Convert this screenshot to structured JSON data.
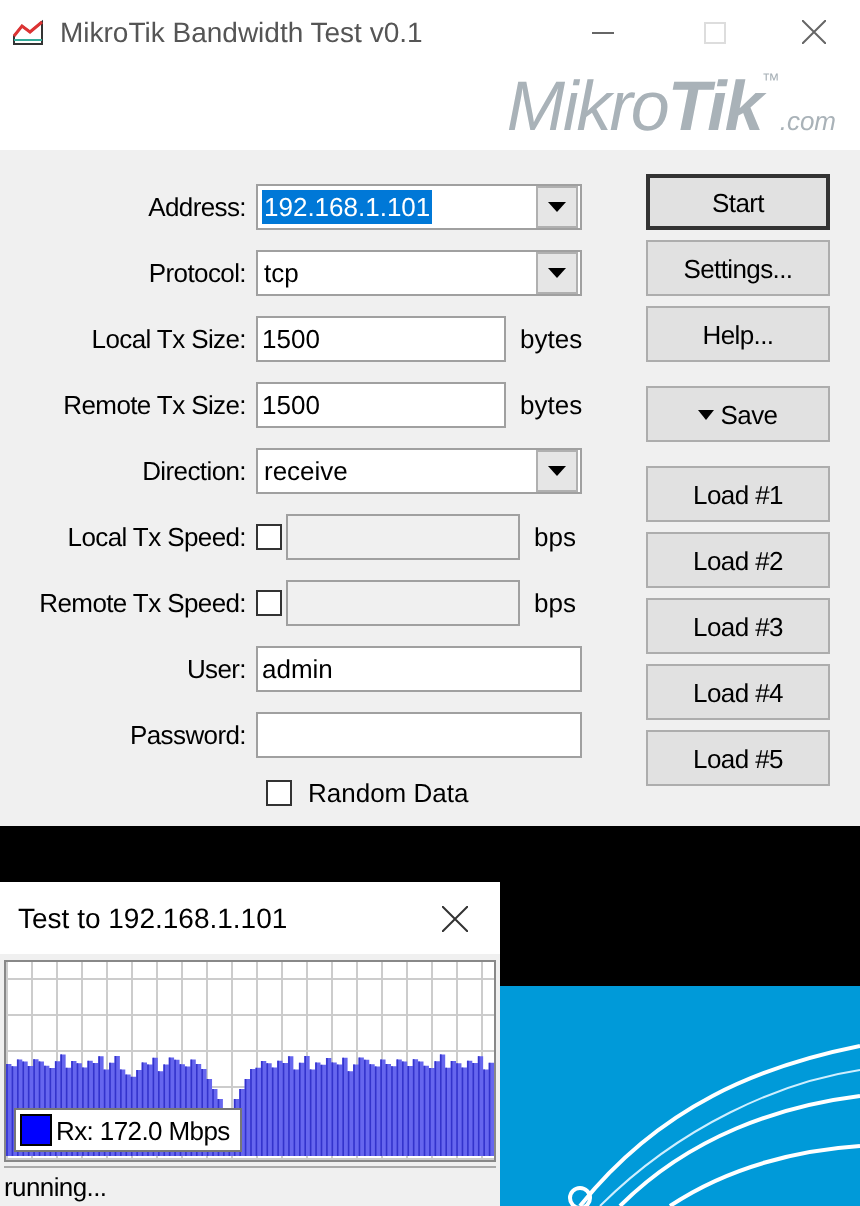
{
  "window": {
    "title": "MikroTik Bandwidth Test v0.1",
    "maximize_disabled": true
  },
  "logo": {
    "word": "Mikro",
    "bold_word": "Tik",
    "mark": "™",
    "suffix": ".com"
  },
  "form": {
    "rows": [
      {
        "kind": "combo",
        "label": "Address:",
        "value": "192.168.1.101",
        "highlighted": true
      },
      {
        "kind": "combo",
        "label": "Protocol:",
        "value": "tcp",
        "highlighted": false
      },
      {
        "kind": "text",
        "label": "Local Tx Size:",
        "value": "1500",
        "unit": "bytes"
      },
      {
        "kind": "text",
        "label": "Remote Tx Size:",
        "value": "1500",
        "unit": "bytes"
      },
      {
        "kind": "combo",
        "label": "Direction:",
        "value": "receive",
        "highlighted": false
      },
      {
        "kind": "speed",
        "label": "Local Tx Speed:",
        "checked": false,
        "unit": "bps"
      },
      {
        "kind": "speed",
        "label": "Remote Tx Speed:",
        "checked": false,
        "unit": "bps"
      },
      {
        "kind": "wide",
        "label": "User:",
        "value": "admin"
      },
      {
        "kind": "wide",
        "label": "Password:"
      }
    ],
    "random_data": {
      "label": "Random Data",
      "checked": false
    }
  },
  "buttons": [
    {
      "kind": "default",
      "label": "Start"
    },
    {
      "kind": "plain",
      "label": "Settings..."
    },
    {
      "kind": "plain",
      "label": "Help..."
    },
    {
      "kind": "menu",
      "label": "Save"
    },
    {
      "kind": "plain",
      "label": "Load #1"
    },
    {
      "kind": "plain",
      "label": "Load #2"
    },
    {
      "kind": "plain",
      "label": "Load #3"
    },
    {
      "kind": "plain",
      "label": "Load #4"
    },
    {
      "kind": "plain",
      "label": "Load #5"
    }
  ],
  "test_window": {
    "title": "Test to 192.168.1.101",
    "legend": {
      "label": "Rx: 172.0 Mbps",
      "color": "#0000ff"
    },
    "status": "running..."
  }
}
